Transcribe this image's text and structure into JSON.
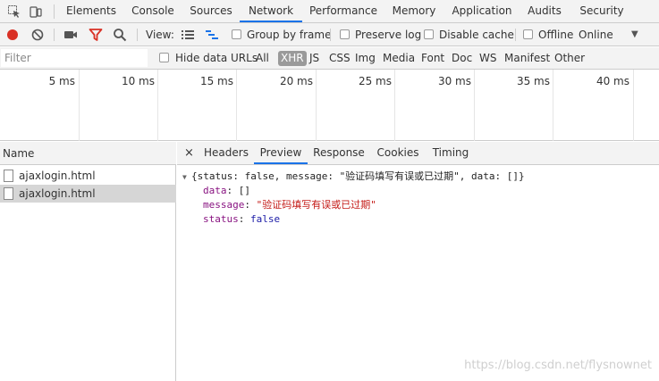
{
  "tabs": {
    "items": [
      "Elements",
      "Console",
      "Sources",
      "Network",
      "Performance",
      "Memory",
      "Application",
      "Audits",
      "Security"
    ],
    "active": "Network"
  },
  "toolbar": {
    "view_label": "View:",
    "group_by_frame": "Group by frame",
    "preserve_log": "Preserve log",
    "disable_cache": "Disable cache",
    "offline": "Offline",
    "throttle": "Online",
    "dropdown_arrow": "▼"
  },
  "filter": {
    "placeholder": "Filter",
    "hide_data_urls": "Hide data URLs",
    "types": [
      "All",
      "XHR",
      "JS",
      "CSS",
      "Img",
      "Media",
      "Font",
      "Doc",
      "WS",
      "Manifest",
      "Other"
    ],
    "selected": "XHR"
  },
  "timeline": {
    "ticks": [
      "5 ms",
      "10 ms",
      "15 ms",
      "20 ms",
      "25 ms",
      "30 ms",
      "35 ms",
      "40 ms"
    ]
  },
  "requests": {
    "header": "Name",
    "rows": [
      "ajaxlogin.html",
      "ajaxlogin.html"
    ],
    "selected_index": 1
  },
  "detail": {
    "close": "×",
    "tabs": [
      "Headers",
      "Preview",
      "Response",
      "Cookies",
      "Timing"
    ],
    "active": "Preview"
  },
  "preview": {
    "summary": "{status: false, message: \"验证码填写有误或已过期\", data: []}",
    "data_key": "data",
    "data_value": "[]",
    "message_key": "message",
    "message_value": "\"验证码填写有误或已过期\"",
    "status_key": "status",
    "status_value": "false"
  },
  "watermark": "https://blog.csdn.net/flysnownet",
  "colors": {
    "accent": "#1a73e8",
    "record": "#d93025",
    "filter_icon": "#d93025",
    "waterfall_icon": "#1a73e8"
  }
}
